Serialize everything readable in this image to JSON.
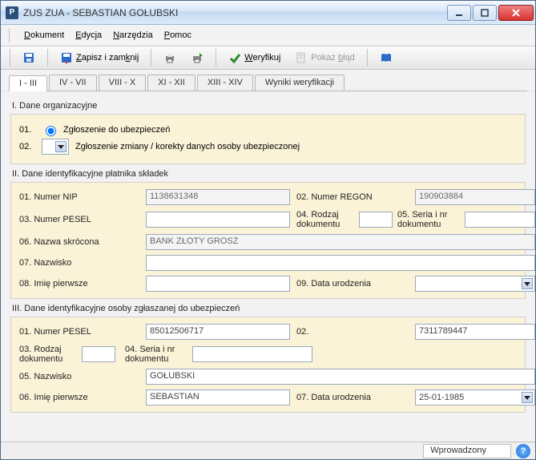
{
  "window": {
    "title": "ZUS ZUA - SEBASTIAN GOŁUBSKI",
    "app_icon_text": "P"
  },
  "menu": {
    "dokument": "Dokument",
    "edycja": "Edycja",
    "narzedzia": "Narzędzia",
    "pomoc": "Pomoc"
  },
  "toolbar": {
    "save_close": "Zapisz i zamknij",
    "verify": "Weryfikuj",
    "show_error": "Pokaż błąd"
  },
  "tabs": {
    "t1": "I - III",
    "t2": "IV - VII",
    "t3": "VIII - X",
    "t4": "XI - XII",
    "t5": "XIII - XIV",
    "t6": "Wyniki weryfikacji"
  },
  "section1": {
    "title": "I. Dane organizacyjne",
    "row1_num": "01.",
    "row1_label": "Zgłoszenie do ubezpieczeń",
    "row2_num": "02.",
    "row2_label": "Zgłoszenie zmiany / korekty danych osoby ubezpieczonej"
  },
  "section2": {
    "title": "II. Dane identyfikacyjne płatnika składek",
    "l_nip": "01. Numer NIP",
    "v_nip": "1138631348",
    "l_regon": "02. Numer REGON",
    "v_regon": "190903884",
    "l_pesel": "03. Numer PESEL",
    "v_pesel": "",
    "l_rodzaj": "04. Rodzaj dokumentu",
    "v_rodzaj": "",
    "l_seria": "05. Seria i nr dokumentu",
    "v_seria": "",
    "l_nazwa": "06. Nazwa skrócona",
    "v_nazwa": "BANK ZŁOTY GROSZ",
    "l_nazw": "07. Nazwisko",
    "v_nazw": "",
    "l_imie": "08. Imię pierwsze",
    "v_imie": "",
    "l_data": "09. Data urodzenia",
    "v_data": ""
  },
  "section3": {
    "title": "III. Dane identyfikacyjne osoby zgłaszanej do ubezpieczeń",
    "l_pesel": "01. Numer PESEL",
    "v_pesel": "85012506717",
    "l_02": "02.",
    "v_02": "7311789447",
    "l_rodzaj": "03. Rodzaj dokumentu",
    "v_rodzaj": "",
    "l_seria": "04. Seria i nr dokumentu",
    "v_seria": "",
    "l_nazw": "05. Nazwisko",
    "v_nazw": "GOŁUBSKI",
    "l_imie": "06. Imię pierwsze",
    "v_imie": "SEBASTIAN",
    "l_data": "07. Data urodzenia",
    "v_data": "25-01-1985"
  },
  "status": {
    "state": "Wprowadzony"
  }
}
